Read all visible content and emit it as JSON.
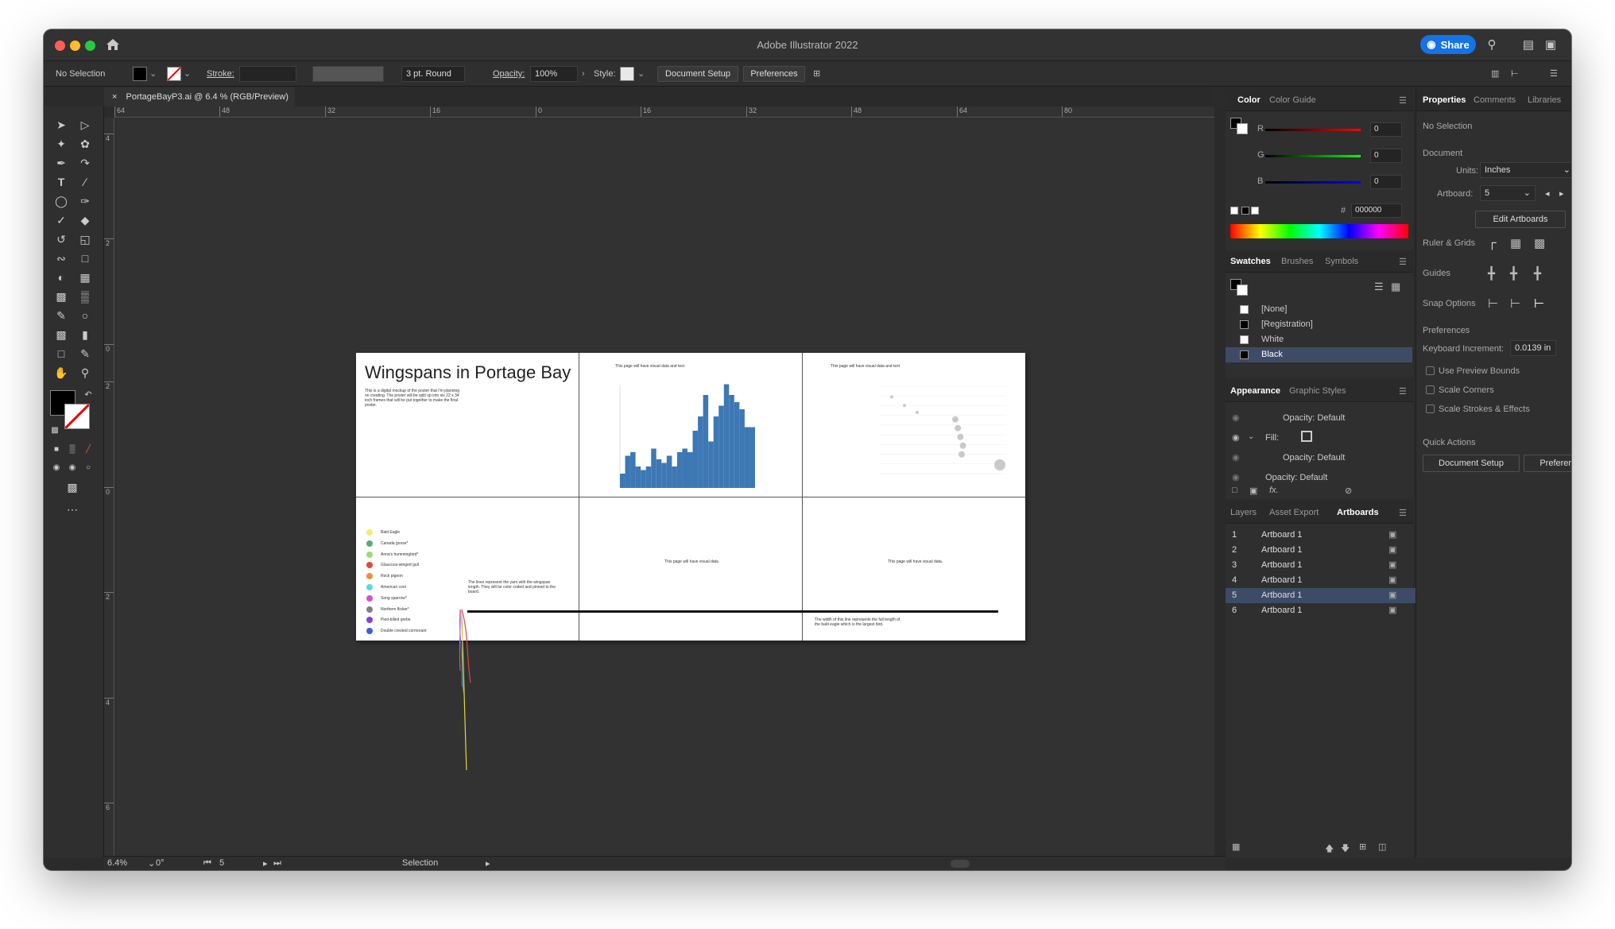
{
  "app": {
    "title": "Adobe Illustrator 2022",
    "share_label": "Share"
  },
  "control_bar": {
    "selection": "No Selection",
    "stroke_label": "Stroke:",
    "brush": "3 pt. Round",
    "opacity_label": "Opacity:",
    "opacity_value": "100%",
    "style_label": "Style:",
    "document_setup": "Document Setup",
    "preferences": "Preferences"
  },
  "document_tab": {
    "name": "PortageBayP3.ai @ 6.4 % (RGB/Preview)"
  },
  "rulers": {
    "horizontal": [
      "64",
      "48",
      "32",
      "16",
      "0",
      "16",
      "32",
      "48",
      "64",
      "80"
    ],
    "vertical": [
      "4",
      "2",
      "0",
      "2",
      "0",
      "2",
      "4",
      "6",
      "8"
    ]
  },
  "status_bar": {
    "zoom": "6.4%",
    "angle": "0°",
    "artboard_num": "5",
    "tool": "Selection"
  },
  "artwork": {
    "title": "Wingspans in Portage Bay",
    "intro": "This is a digital mockup of the poster that I'm planning on creating. The poster will be split up into six 22 x 34 inch frames that will be put together to make the final poster.",
    "panel2_note": "This page will have visual data and text",
    "panel3_note": "This page will have visual data and text",
    "panel5_note": "This page will have visual data",
    "panel6_note": "This page will have visual data.",
    "lines_note": "The lines represent the yarn with the wingspan length. They will be color coded and pinned to the board.",
    "width_note": "The width of this line represents the full length of the bald eagle which is the largest bird.",
    "bar_values": [
      4,
      9,
      10,
      6,
      5,
      6,
      11,
      8,
      7,
      9,
      6,
      10,
      11,
      10,
      16,
      20,
      26,
      13,
      20,
      23,
      29,
      26,
      24,
      22,
      17,
      17
    ],
    "bubble_points": [
      {
        "x": 1,
        "y": 88,
        "s": 2
      },
      {
        "x": 2,
        "y": 78,
        "s": 2
      },
      {
        "x": 3,
        "y": 70,
        "s": 2
      },
      {
        "x": 6,
        "y": 62,
        "s": 4
      },
      {
        "x": 6.2,
        "y": 52,
        "s": 4
      },
      {
        "x": 6.4,
        "y": 42,
        "s": 4
      },
      {
        "x": 6.6,
        "y": 32,
        "s": 4
      },
      {
        "x": 6.5,
        "y": 22,
        "s": 4
      },
      {
        "x": 9.5,
        "y": 10,
        "s": 7
      }
    ],
    "legend": [
      {
        "name": "Bald Eagle",
        "color": "#f2f06a"
      },
      {
        "name": "Canada goose*",
        "color": "#5aa97a"
      },
      {
        "name": "Anna's hummingbird*",
        "color": "#9ddc73"
      },
      {
        "name": "Glaucous-winged gull",
        "color": "#e0483b"
      },
      {
        "name": "Rock pigeon",
        "color": "#f08d3a"
      },
      {
        "name": "American coot",
        "color": "#5ad6ea"
      },
      {
        "name": "Song sparrow*",
        "color": "#d64fc9"
      },
      {
        "name": "Northern flicker*",
        "color": "#808080"
      },
      {
        "name": "Pied-billed grebe",
        "color": "#8a3ed6"
      },
      {
        "name": "Double crested cormorant",
        "color": "#3b5ee0"
      }
    ]
  },
  "color_panel": {
    "tabs": [
      "Color",
      "Color Guide"
    ],
    "r_label": "R",
    "g_label": "G",
    "b_label": "B",
    "r": "0",
    "g": "0",
    "b": "0",
    "hex_label": "#",
    "hex": "000000"
  },
  "swatches_panel": {
    "tabs": [
      "Swatches",
      "Brushes",
      "Symbols"
    ],
    "items": [
      "[None]",
      "[Registration]",
      "White",
      "Black"
    ]
  },
  "appearance_panel": {
    "tabs": [
      "Appearance",
      "Graphic Styles"
    ],
    "opacity1": "Opacity: Default",
    "fill": "Fill:",
    "opacity2": "Opacity: Default",
    "opacity3": "Opacity: Default"
  },
  "layers_panel": {
    "tabs": [
      "Layers",
      "Asset Export",
      "Artboards"
    ],
    "rows": [
      {
        "num": "1",
        "name": "Artboard 1"
      },
      {
        "num": "2",
        "name": "Artboard 1"
      },
      {
        "num": "3",
        "name": "Artboard 1"
      },
      {
        "num": "4",
        "name": "Artboard 1"
      },
      {
        "num": "5",
        "name": "Artboard 1"
      },
      {
        "num": "6",
        "name": "Artboard 1"
      }
    ]
  },
  "properties_panel": {
    "tabs": [
      "Properties",
      "Comments",
      "Libraries"
    ],
    "no_selection": "No Selection",
    "document": "Document",
    "units_label": "Units:",
    "units_value": "Inches",
    "artboard_label": "Artboard:",
    "artboard_value": "5",
    "edit_artboards": "Edit Artboards",
    "ruler_grids": "Ruler & Grids",
    "guides": "Guides",
    "snap_options": "Snap Options",
    "preferences": "Preferences",
    "kb_increment_label": "Keyboard Increment:",
    "kb_increment_value": "0.0139 in",
    "use_preview_bounds": "Use Preview Bounds",
    "scale_corners": "Scale Corners",
    "scale_strokes": "Scale Strokes & Effects",
    "quick_actions": "Quick Actions",
    "document_setup": "Document Setup",
    "preferences_btn": "Preferences"
  }
}
